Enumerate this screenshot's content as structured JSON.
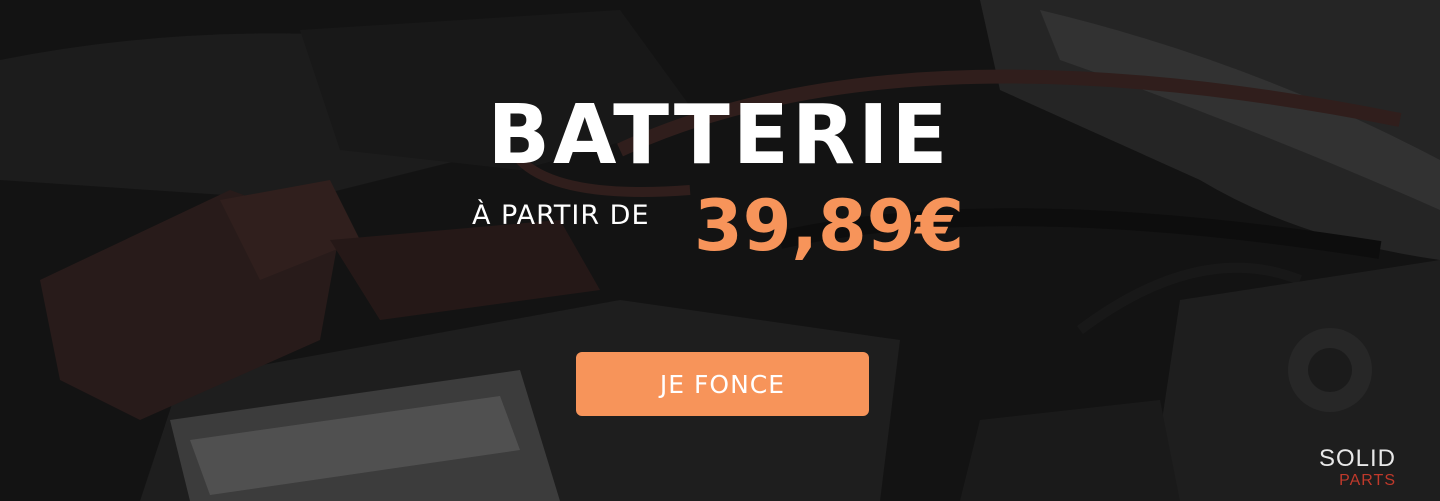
{
  "banner": {
    "title": "BATTERIE",
    "from_label": "À PARTIR DE",
    "price": "39,89€",
    "cta_label": "JE FONCE",
    "logo": {
      "top": "SOLID",
      "bottom": "PARTS"
    }
  },
  "colors": {
    "accent": "#f7945a",
    "title": "#ffffff",
    "logo_red": "#c0392b",
    "logo_light": "#e8e8e8"
  }
}
